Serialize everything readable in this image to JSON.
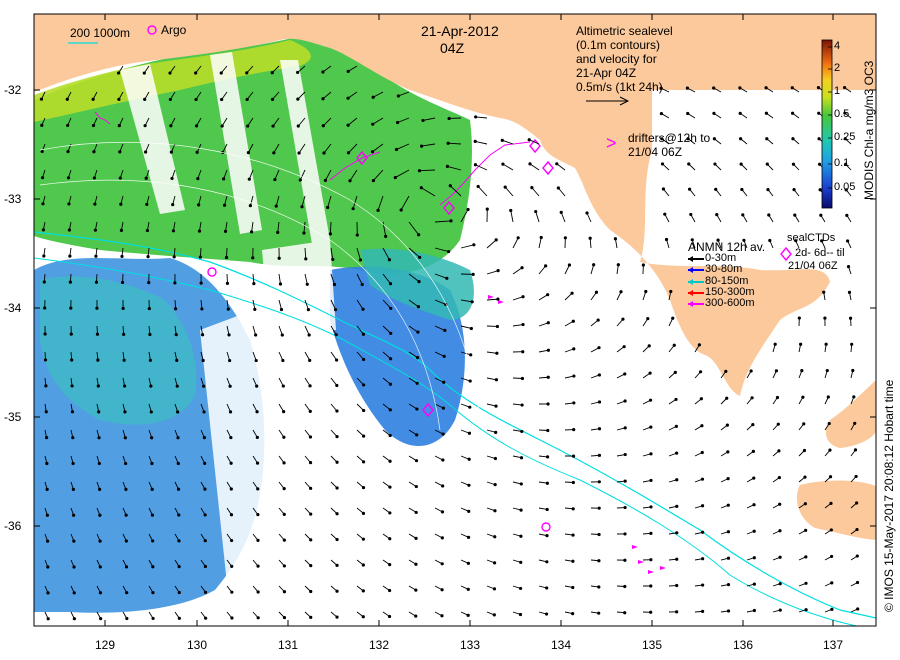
{
  "header": {
    "date": "21-Apr-2012",
    "time": "04Z",
    "scale_label": "200  1000m",
    "argo_label": "Argo"
  },
  "sealevel_note": {
    "line1": "Altimetric sealevel",
    "line2": "(0.1m contours)",
    "line3": "and velocity for",
    "line4": "21-Apr 04Z",
    "line5": "0.5m/s (1kt 24h)"
  },
  "drifters_note": {
    "symbol": ">",
    "line1": "drifters@12h to",
    "line2": "21/04 06Z"
  },
  "anmn_legend": {
    "title": "ANMN 12h av.",
    "items": [
      {
        "label": "0-30m",
        "color": "#000000"
      },
      {
        "label": "30-80m",
        "color": "#0000ff"
      },
      {
        "label": "80-150m",
        "color": "#00c8c8"
      },
      {
        "label": "150-300m",
        "color": "#ff0000"
      },
      {
        "label": "300-600m",
        "color": "#ff00ff"
      }
    ]
  },
  "sealctd_legend": {
    "title": "sealCTDs",
    "line1": "2d- 6d-- til",
    "line2": "21/04 06Z"
  },
  "colorbar": {
    "title": "MODIS Chl-a mg/m3 OC3",
    "ticks": [
      "4",
      "2",
      "1",
      "0.5",
      "0.25",
      "0.1",
      "0.05"
    ]
  },
  "credit": "© IMOS 15-May-2017 20:08:12 Hobart time",
  "axes": {
    "x_ticks": [
      "129",
      "130",
      "131",
      "132",
      "133",
      "134",
      "135",
      "136",
      "137"
    ],
    "y_ticks": [
      "-32",
      "-33",
      "-34",
      "-35",
      "-36"
    ]
  },
  "colors": {
    "land": "#fbc99b",
    "ocean_blue": "#3a8ee0",
    "ocean_green": "#43c24a",
    "ocean_cyan": "#36bdb0",
    "isobath": "#00dede",
    "accent": "#ff00ff"
  }
}
